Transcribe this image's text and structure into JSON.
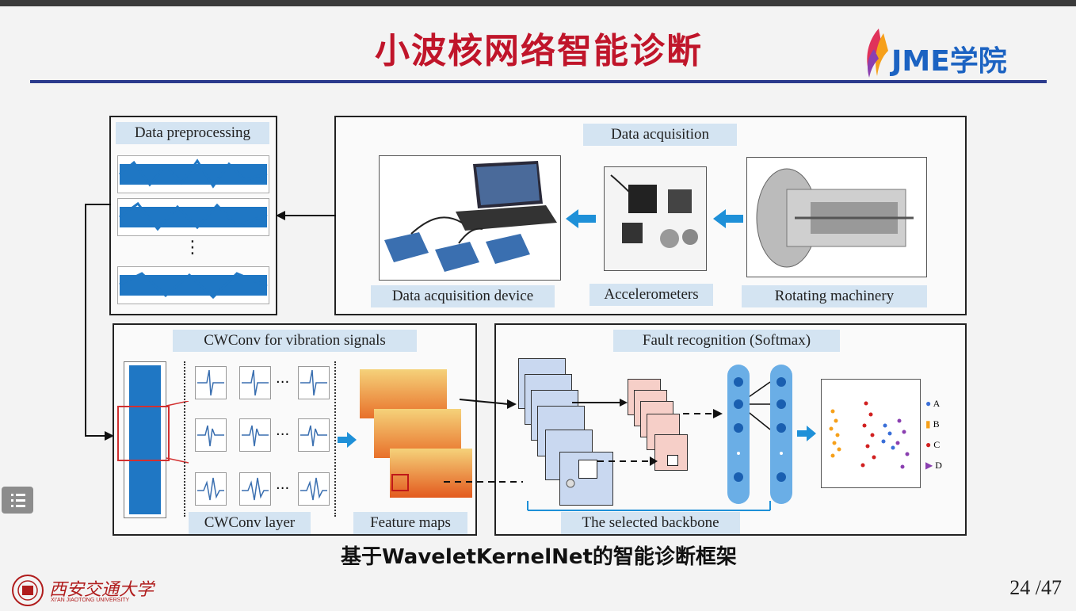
{
  "slide": {
    "title": "小波核网络智能诊断",
    "logo_text": "JME学院",
    "caption": "基于WaveletKernelNet的智能诊断框架",
    "page_number": "24 /47",
    "university_name": "西安交通大学",
    "university_sub": "XI'AN JIAOTONG UNIVERSITY"
  },
  "diagram": {
    "data_preprocessing": "Data preprocessing",
    "data_acquisition": "Data acquisition",
    "acquisition_device": "Data acquisition device",
    "accelerometers": "Accelerometers",
    "rotating_machinery": "Rotating machinery",
    "cwconv_title": "CWConv for vibration signals",
    "cwconv_layer": "CWConv layer",
    "feature_maps": "Feature maps",
    "fault_recognition": "Fault recognition (Softmax)",
    "selected_backbone": "The selected backbone",
    "dots": "⋮",
    "hdots": "···",
    "legend": [
      "A",
      "B",
      "C",
      "D"
    ]
  },
  "colors": {
    "title": "#c0152a",
    "rule": "#2b3a8c",
    "label_bg": "#d4e4f2",
    "arrow_blue": "#1e90d8",
    "signal": "#1f77c4"
  },
  "icons": {
    "menu": "menu-icon"
  }
}
